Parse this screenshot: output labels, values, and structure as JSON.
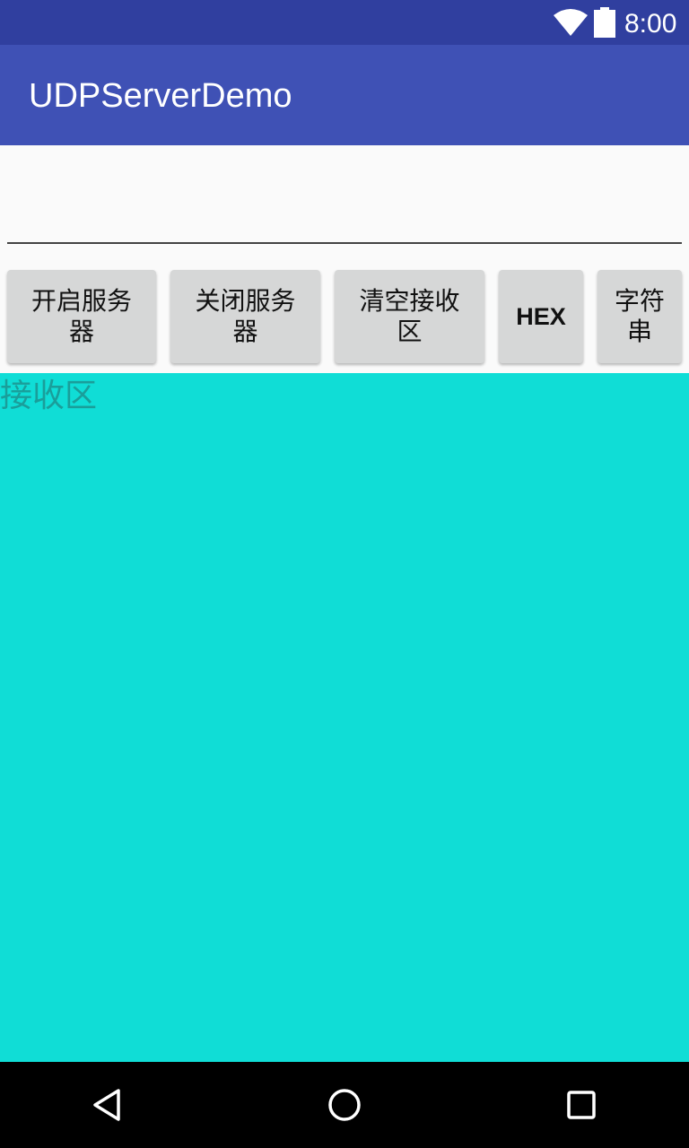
{
  "status_bar": {
    "time": "8:00",
    "icons": [
      "wifi-icon",
      "battery-icon"
    ]
  },
  "app_bar": {
    "title": "UDPServerDemo"
  },
  "input": {
    "value": "",
    "placeholder": ""
  },
  "buttons": {
    "start_server": "开启服务器",
    "stop_server": "关闭服务器",
    "clear_receive": "清空接收区",
    "hex": "HEX",
    "string": "字符串"
  },
  "receive_area": {
    "hint": "接收区",
    "background_color": "#10DDD6"
  },
  "nav_bar": {
    "icons": [
      "back-icon",
      "home-icon",
      "recents-icon"
    ]
  },
  "colors": {
    "status_bar": "#303F9F",
    "app_bar": "#3F51B5",
    "button": "#D6D7D7"
  }
}
